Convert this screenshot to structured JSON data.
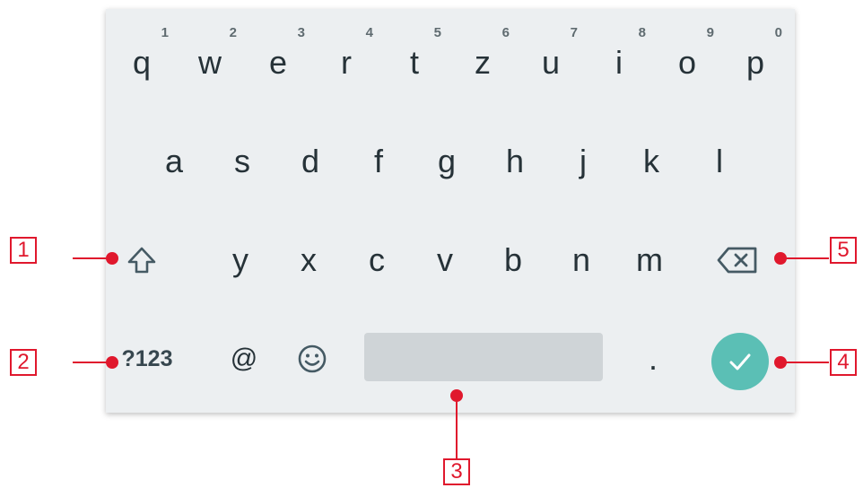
{
  "keyboard": {
    "row1": [
      {
        "label": "q",
        "hint": "1"
      },
      {
        "label": "w",
        "hint": "2"
      },
      {
        "label": "e",
        "hint": "3"
      },
      {
        "label": "r",
        "hint": "4"
      },
      {
        "label": "t",
        "hint": "5"
      },
      {
        "label": "z",
        "hint": "6"
      },
      {
        "label": "u",
        "hint": "7"
      },
      {
        "label": "i",
        "hint": "8"
      },
      {
        "label": "o",
        "hint": "9"
      },
      {
        "label": "p",
        "hint": "0"
      }
    ],
    "row2": [
      "a",
      "s",
      "d",
      "f",
      "g",
      "h",
      "j",
      "k",
      "l"
    ],
    "row3": [
      "y",
      "x",
      "c",
      "v",
      "b",
      "n",
      "m"
    ],
    "bottom": {
      "symbols_label": "?123",
      "at_label": "@",
      "period_label": "."
    },
    "icons": {
      "shift": "shift-icon",
      "backspace": "backspace-icon",
      "emoji": "emoji-icon",
      "enter": "check-icon"
    },
    "colors": {
      "background": "#eceff1",
      "key_text": "#263238",
      "spacebar": "#cfd4d7",
      "enter": "#5bbfb5",
      "callout": "#e0182d"
    }
  },
  "callouts": [
    "1",
    "2",
    "3",
    "4",
    "5"
  ]
}
